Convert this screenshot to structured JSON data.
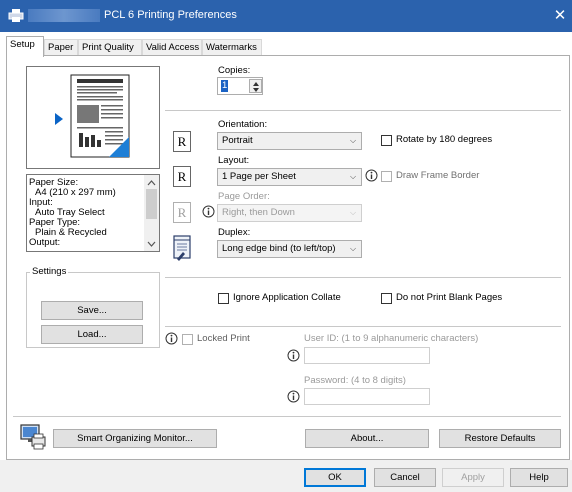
{
  "window": {
    "title": "PCL 6 Printing Preferences",
    "close_glyph": "✕"
  },
  "tabs": [
    {
      "label": "Setup"
    },
    {
      "label": "Paper"
    },
    {
      "label": "Print Quality"
    },
    {
      "label": "Valid Access"
    },
    {
      "label": "Watermarks"
    }
  ],
  "copies": {
    "label": "Copies:",
    "value": "1"
  },
  "summary_list": [
    "Paper Size:",
    "  A4 (210 x 297 mm)",
    "Input:",
    "  Auto Tray Select",
    "Paper Type:",
    "  Plain & Recycled",
    "Output:"
  ],
  "settings": {
    "group_label": "Settings",
    "save_button": "Save...",
    "load_button": "Load..."
  },
  "orientation": {
    "label": "Orientation:",
    "value": "Portrait",
    "rotate_label": "Rotate by 180 degrees"
  },
  "layout": {
    "label": "Layout:",
    "value": "1 Page per Sheet",
    "frame_label": "Draw Frame Border"
  },
  "page_order": {
    "label": "Page Order:",
    "value": "Right, then Down"
  },
  "duplex": {
    "label": "Duplex:",
    "value": "Long edge bind (to left/top)"
  },
  "options": {
    "collate_label": "Ignore Application Collate",
    "blank_label": "Do not Print Blank Pages"
  },
  "locked_print": {
    "label": "Locked Print",
    "user_id_label": "User ID: (1 to 9 alphanumeric characters)",
    "password_label": "Password: (4 to 8 digits)"
  },
  "bottom_buttons": {
    "monitor": "Smart Organizing Monitor...",
    "about": "About...",
    "restore": "Restore Defaults"
  },
  "footer": {
    "ok": "OK",
    "cancel": "Cancel",
    "apply": "Apply",
    "help": "Help"
  },
  "icons": {
    "r_glyph": "R"
  }
}
